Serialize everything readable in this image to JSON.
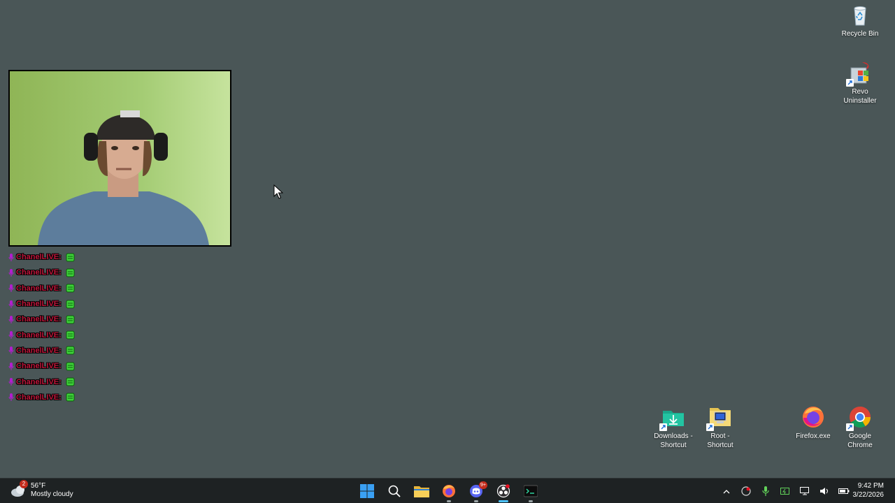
{
  "desktop": {
    "icons": [
      {
        "label": "Recycle Bin",
        "icon": "recycle-bin-icon"
      },
      {
        "label": "Revo Uninstaller",
        "icon": "revo-uninstaller-icon"
      },
      {
        "label": "Downloads - Shortcut",
        "icon": "downloads-folder-icon"
      },
      {
        "label": "Root - Shortcut",
        "icon": "root-folder-icon"
      },
      {
        "label": "Firefox.exe",
        "icon": "firefox-icon"
      },
      {
        "label": "Google Chrome",
        "icon": "chrome-icon"
      }
    ]
  },
  "chat": {
    "username": "ChanelLIVE:",
    "name_color": "#c0163b",
    "lines": [
      "ChanelLIVE:",
      "ChanelLIVE:",
      "ChanelLIVE:",
      "ChanelLIVE:",
      "ChanelLIVE:",
      "ChanelLIVE:",
      "ChanelLIVE:",
      "ChanelLIVE:",
      "ChanelLIVE:",
      "ChanelLIVE:"
    ]
  },
  "taskbar": {
    "weather": {
      "badge": "2",
      "temp": "56°F",
      "condition": "Mostly cloudy"
    },
    "apps": [
      {
        "name": "start-button",
        "icon": "windows-logo-icon"
      },
      {
        "name": "search-button",
        "icon": "search-icon"
      },
      {
        "name": "file-explorer-button",
        "icon": "folder-icon"
      },
      {
        "name": "firefox-taskbar-button",
        "icon": "firefox-icon"
      },
      {
        "name": "discord-taskbar-button",
        "icon": "discord-icon",
        "badge": "9+"
      },
      {
        "name": "obs-taskbar-button",
        "icon": "obs-icon"
      },
      {
        "name": "terminal-taskbar-button",
        "icon": "terminal-icon"
      }
    ],
    "clock": {
      "time": "9:42 PM",
      "date": "3/22/2026"
    }
  },
  "colors": {
    "desktop_bg": "#4a5657",
    "taskbar_bg": "#1e2223",
    "accent": "#4cc2ff"
  }
}
